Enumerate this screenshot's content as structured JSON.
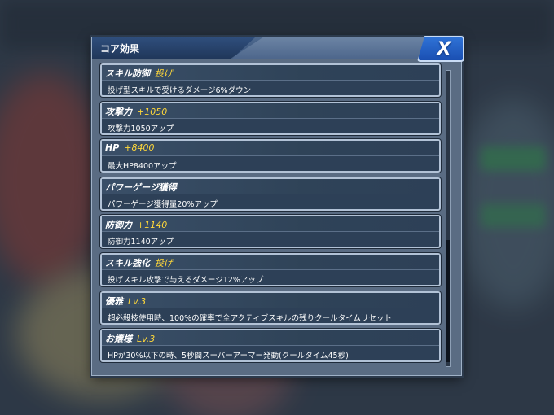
{
  "dialog": {
    "title": "コア効果",
    "close_label": "X"
  },
  "effects": [
    {
      "name": "スキル防御",
      "value": "投げ",
      "desc": "投げ型スキルで受けるダメージ6%ダウン"
    },
    {
      "name": "攻撃力",
      "value": "+1050",
      "desc": "攻撃力1050アップ"
    },
    {
      "name": "HP",
      "value": "+8400",
      "desc": "最大HP8400アップ"
    },
    {
      "name": "パワーゲージ獲得",
      "value": "",
      "desc": "パワーゲージ獲得量20%アップ"
    },
    {
      "name": "防御力",
      "value": "+1140",
      "desc": "防御力1140アップ"
    },
    {
      "name": "スキル強化",
      "value": "投げ",
      "desc": "投げスキル攻撃で与えるダメージ12%アップ"
    },
    {
      "name": "優雅",
      "value": "Lv.3",
      "desc": "超必殺技使用時、100%の確率で全アクティブスキルの残りクールタイムリセット"
    },
    {
      "name": "お嬢様",
      "value": "Lv.3",
      "desc": "HPが30%以下の時、5秒間スーパーアーマー発動(クールタイム45秒)"
    }
  ],
  "colors": {
    "value_accent": "#ffd83a",
    "close_button": "#1f5fc4",
    "card_bg": "#2d4057"
  }
}
